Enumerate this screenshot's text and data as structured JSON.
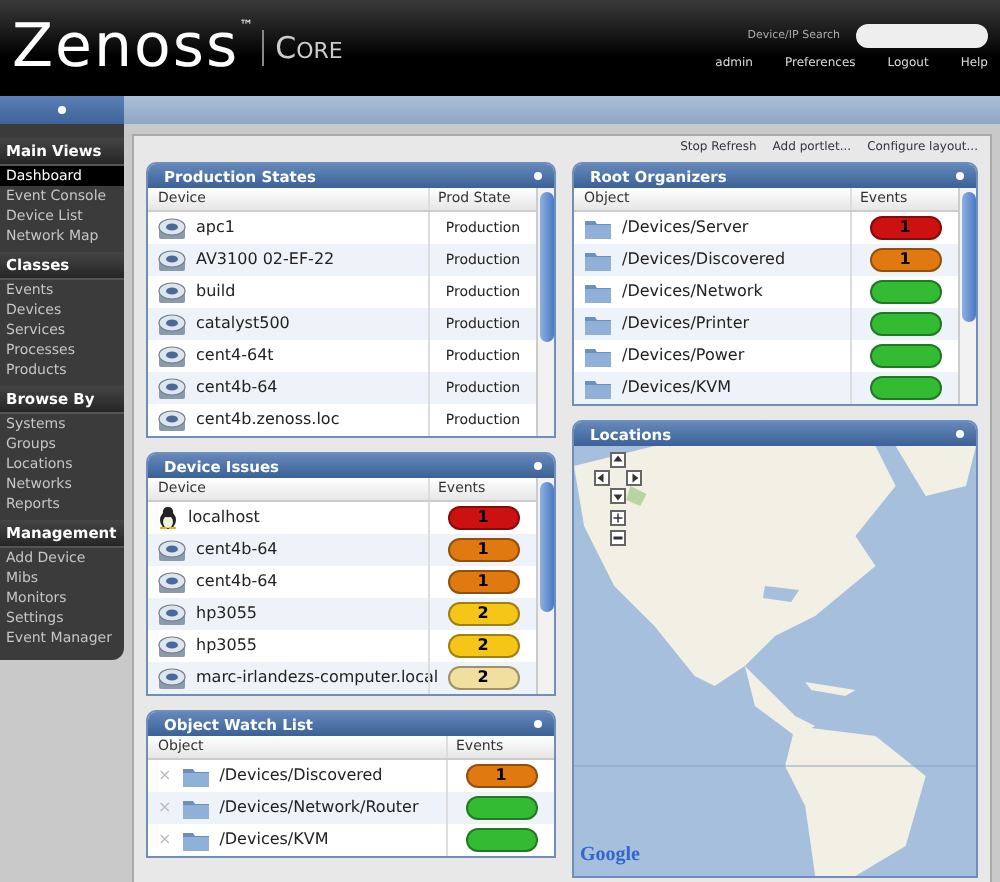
{
  "header": {
    "logo": "Zenoss",
    "trademark": "™",
    "product": "Core",
    "search_label": "Device/IP Search",
    "links": [
      "admin",
      "Preferences",
      "Logout",
      "Help"
    ]
  },
  "sidebar": {
    "sections": [
      {
        "title": "Main Views",
        "items": [
          {
            "label": "Dashboard",
            "selected": true
          },
          {
            "label": "Event Console",
            "selected": false
          },
          {
            "label": "Device List",
            "selected": false
          },
          {
            "label": "Network Map",
            "selected": false
          }
        ]
      },
      {
        "title": "Classes",
        "items": [
          {
            "label": "Events",
            "selected": false
          },
          {
            "label": "Devices",
            "selected": false
          },
          {
            "label": "Services",
            "selected": false
          },
          {
            "label": "Processes",
            "selected": false
          },
          {
            "label": "Products",
            "selected": false
          }
        ]
      },
      {
        "title": "Browse By",
        "items": [
          {
            "label": "Systems",
            "selected": false
          },
          {
            "label": "Groups",
            "selected": false
          },
          {
            "label": "Locations",
            "selected": false
          },
          {
            "label": "Networks",
            "selected": false
          },
          {
            "label": "Reports",
            "selected": false
          }
        ]
      },
      {
        "title": "Management",
        "items": [
          {
            "label": "Add Device",
            "selected": false
          },
          {
            "label": "Mibs",
            "selected": false
          },
          {
            "label": "Monitors",
            "selected": false
          },
          {
            "label": "Settings",
            "selected": false
          },
          {
            "label": "Event Manager",
            "selected": false
          }
        ]
      }
    ]
  },
  "toolbar": {
    "links": [
      "Stop Refresh",
      "Add portlet...",
      "Configure layout..."
    ]
  },
  "left_column": [
    {
      "kind": "scroll_table",
      "title": "Production States",
      "columns": [
        "Device",
        "Prod State"
      ],
      "rows": [
        {
          "kind": "server",
          "name": "apc1",
          "prod_state": "Production"
        },
        {
          "kind": "server",
          "name": "AV3100 02-EF-22",
          "prod_state": "Production"
        },
        {
          "kind": "server",
          "name": "build",
          "prod_state": "Production"
        },
        {
          "kind": "server",
          "name": "catalyst500",
          "prod_state": "Production"
        },
        {
          "kind": "server",
          "name": "cent4-64t",
          "prod_state": "Production"
        },
        {
          "kind": "server",
          "name": "cent4b-64",
          "prod_state": "Production"
        },
        {
          "kind": "server",
          "name": "cent4b.zenoss.loc",
          "prod_state": "Production"
        }
      ]
    },
    {
      "kind": "scroll_table",
      "title": "Device Issues",
      "columns": [
        "Device",
        "Events"
      ],
      "rows": [
        {
          "kind": "linux",
          "name": "localhost",
          "events": {
            "count": "1",
            "color": "#cc1111"
          }
        },
        {
          "kind": "server",
          "name": "cent4b-64",
          "events": {
            "count": "1",
            "color": "#e07a10"
          }
        },
        {
          "kind": "server",
          "name": "cent4b-64",
          "events": {
            "count": "1",
            "color": "#e07a10"
          }
        },
        {
          "kind": "server",
          "name": "hp3055",
          "events": {
            "count": "2",
            "color": "#f5c518"
          }
        },
        {
          "kind": "server",
          "name": "hp3055",
          "events": {
            "count": "2",
            "color": "#f5c518"
          }
        },
        {
          "kind": "server",
          "name": "marc-irlandezs-computer.local",
          "events": {
            "count": "2",
            "color": "#f1dfa0"
          }
        }
      ]
    },
    {
      "kind": "table",
      "title": "Object Watch List",
      "columns": [
        "Object",
        "Events"
      ],
      "rows": [
        {
          "kind": "folder",
          "remove": "×",
          "name": "/Devices/Discovered",
          "events": {
            "count": "1",
            "color": "#e07a10"
          }
        },
        {
          "kind": "folder",
          "remove": "×",
          "name": "/Devices/Network/Router",
          "events": {
            "color": "#33bb33"
          }
        },
        {
          "kind": "folder",
          "remove": "×",
          "name": "/Devices/KVM",
          "events": {
            "color": "#33bb33"
          }
        }
      ]
    }
  ],
  "right_column": [
    {
      "kind": "scroll_table",
      "title": "Root Organizers",
      "columns": [
        "Object",
        "Events"
      ],
      "rows": [
        {
          "kind": "folder",
          "name": "/Devices/Server",
          "events": {
            "count": "1",
            "color": "#cc1111"
          }
        },
        {
          "kind": "folder",
          "name": "/Devices/Discovered",
          "events": {
            "count": "1",
            "color": "#e07a10"
          }
        },
        {
          "kind": "folder",
          "name": "/Devices/Network",
          "events": {
            "color": "#33bb33"
          }
        },
        {
          "kind": "folder",
          "name": "/Devices/Printer",
          "events": {
            "color": "#33bb33"
          }
        },
        {
          "kind": "folder",
          "name": "/Devices/Power",
          "events": {
            "color": "#33bb33"
          }
        },
        {
          "kind": "folder",
          "name": "/Devices/KVM",
          "events": {
            "color": "#33bb33"
          }
        }
      ]
    },
    {
      "kind": "map",
      "title": "Locations",
      "attribution": "Google"
    }
  ]
}
